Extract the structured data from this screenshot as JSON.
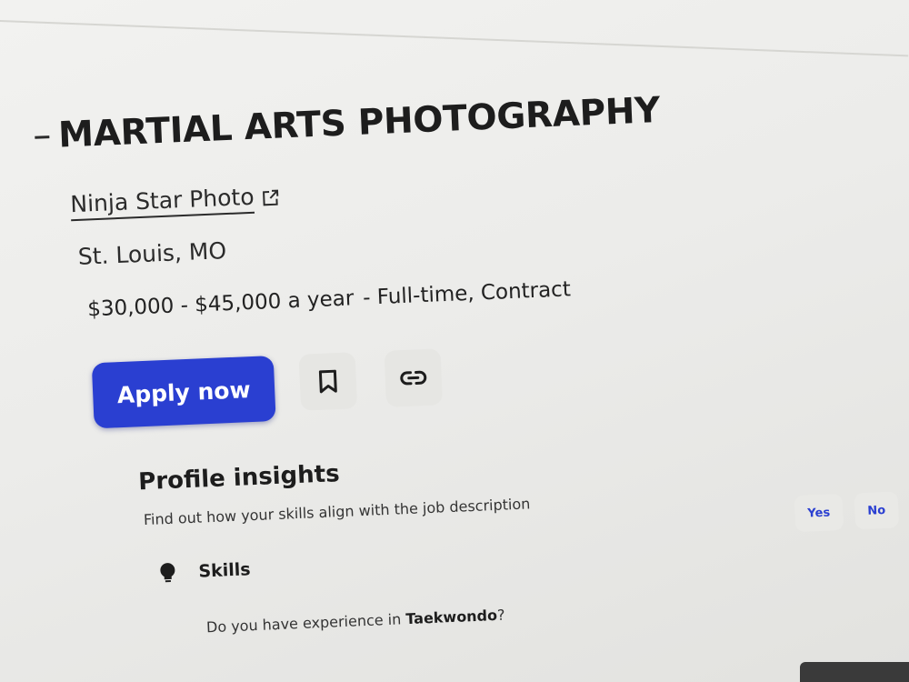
{
  "job": {
    "title": "MARTIAL ARTS PHOTOGRAPHY",
    "company": "Ninja Star Photo",
    "location": "St. Louis, MO",
    "salary": "$30,000 - $45,000 a year",
    "job_type": "- Full-time, Contract"
  },
  "actions": {
    "apply_label": "Apply now",
    "save_icon": "bookmark-icon",
    "copy_link_icon": "link-icon"
  },
  "insights": {
    "title": "Profile insights",
    "subtitle": "Find out how your skills align with the job description",
    "skills_label": "Skills",
    "question_prefix": "Do you have experience in ",
    "question_skill": "Taekwondo",
    "question_suffix": "?",
    "yes_label": "Yes",
    "no_label": "No"
  },
  "colors": {
    "accent": "#2a3fd1",
    "text": "#1d1d1d",
    "background": "#f2f2f0"
  }
}
